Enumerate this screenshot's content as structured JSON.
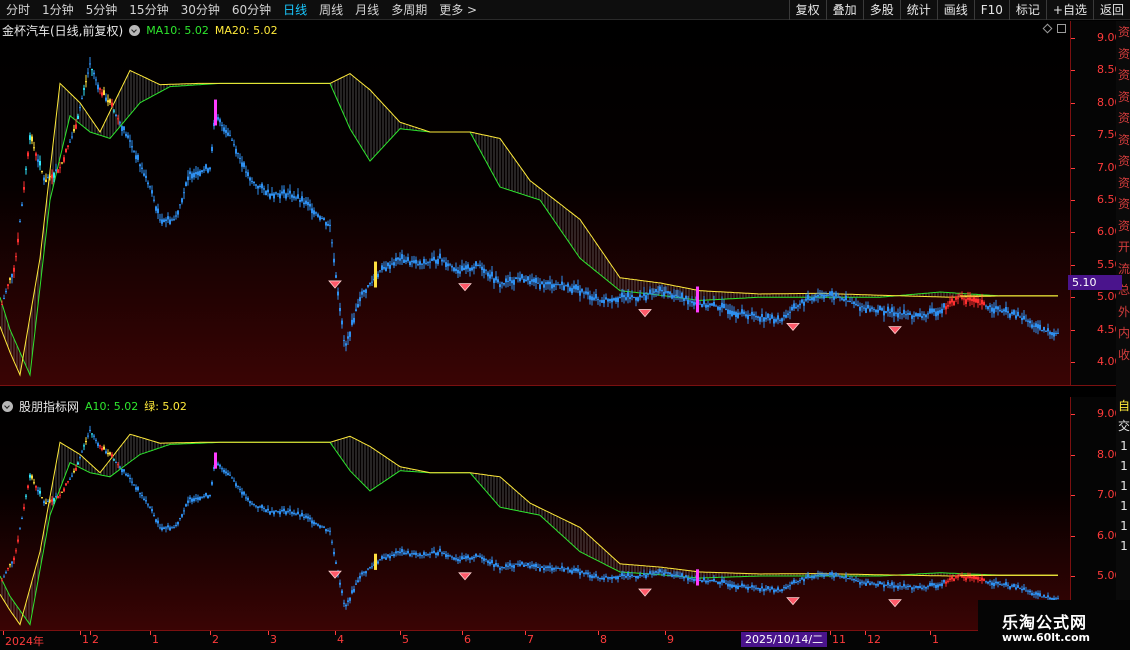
{
  "toolbar": {
    "periods": [
      {
        "label": "分时",
        "active": false
      },
      {
        "label": "1分钟",
        "active": false
      },
      {
        "label": "5分钟",
        "active": false
      },
      {
        "label": "15分钟",
        "active": false
      },
      {
        "label": "30分钟",
        "active": false
      },
      {
        "label": "60分钟",
        "active": false
      },
      {
        "label": "日线",
        "active": true
      },
      {
        "label": "周线",
        "active": false
      },
      {
        "label": "月线",
        "active": false
      },
      {
        "label": "多周期",
        "active": false
      },
      {
        "label": "更多 >",
        "active": false
      }
    ],
    "buttons": [
      "复权",
      "叠加",
      "多股",
      "统计",
      "画线",
      "F10",
      "标记",
      "+自选",
      "返回"
    ]
  },
  "top_pane": {
    "title": "金杯汽车(日线,前复权)",
    "ma10": "MA10: 5.02",
    "ma20": "MA20: 5.02",
    "axis_labels": [
      "9.00",
      "8.50",
      "8.00",
      "7.50",
      "7.00",
      "6.50",
      "6.00",
      "5.50",
      "5.00",
      "4.50",
      "4.00"
    ],
    "axis_values": [
      9.0,
      8.5,
      8.0,
      7.5,
      7.0,
      6.5,
      6.0,
      5.5,
      5.0,
      4.5,
      4.0
    ],
    "current_price": "5.10"
  },
  "bottom_pane": {
    "title": "股朋指标网",
    "a10": "A10: 5.02",
    "green": "绿: 5.02",
    "axis_labels": [
      "9.00",
      "8.00",
      "7.00",
      "6.00",
      "5.00"
    ],
    "axis_values": [
      9.0,
      8.0,
      7.0,
      6.0,
      5.0
    ]
  },
  "side_strip": {
    "top_chars": [
      "资",
      "资",
      "资",
      "资",
      "资",
      "资",
      "资",
      "资",
      "资",
      "资",
      "开",
      "流",
      "总",
      "外",
      "内",
      "收"
    ],
    "bottom_chars": [
      "自",
      "交",
      "1",
      "1",
      "1",
      "1",
      "1",
      "1"
    ]
  },
  "date_axis": {
    "labels": [
      "2024年",
      "1",
      "2",
      "1",
      "2",
      "3",
      "4",
      "5",
      "6",
      "7",
      "8",
      "9",
      "11",
      "12",
      "1"
    ],
    "cursor": "2025/10/14/二"
  },
  "watermark": {
    "title": "乐淘公式网",
    "url": "www.60lt.com"
  },
  "colors": {
    "accent_active": "#19c8ff",
    "axis": "#ff3b3b",
    "ma10": "#2ee62e",
    "ma20": "#ffea3a",
    "price_line": "#2e8fef",
    "band_fill": "#a0a0a0",
    "highlight": "#4a148c"
  },
  "chart_data": [
    {
      "type": "line",
      "title": "金杯汽车(日线,前复权)",
      "ylim": [
        3.75,
        9.2
      ],
      "x_index_range": [
        0,
        520
      ],
      "series": [
        {
          "name": "MA10",
          "points": [
            [
              0,
              4.55
            ],
            [
              10,
              4.15
            ],
            [
              20,
              3.8
            ],
            [
              40,
              5.6
            ],
            [
              60,
              8.3
            ],
            [
              80,
              8.0
            ],
            [
              100,
              7.55
            ],
            [
              130,
              8.5
            ],
            [
              160,
              8.28
            ],
            [
              200,
              8.3
            ],
            [
              260,
              8.3
            ],
            [
              300,
              8.3
            ],
            [
              330,
              8.3
            ],
            [
              350,
              8.45
            ],
            [
              370,
              8.2
            ],
            [
              400,
              7.7
            ],
            [
              430,
              7.55
            ],
            [
              470,
              7.55
            ],
            [
              500,
              7.45
            ],
            [
              530,
              6.8
            ],
            [
              580,
              6.2
            ],
            [
              620,
              5.3
            ],
            [
              660,
              5.22
            ],
            [
              700,
              5.1
            ],
            [
              760,
              5.05
            ],
            [
              820,
              5.06
            ],
            [
              880,
              5.03
            ],
            [
              950,
              5.0
            ],
            [
              1000,
              5.02
            ],
            [
              1060,
              5.02
            ]
          ]
        },
        {
          "name": "MA20",
          "points": [
            [
              0,
              5.0
            ],
            [
              10,
              4.5
            ],
            [
              30,
              3.8
            ],
            [
              50,
              6.5
            ],
            [
              70,
              7.8
            ],
            [
              90,
              7.55
            ],
            [
              110,
              7.45
            ],
            [
              140,
              8.0
            ],
            [
              170,
              8.25
            ],
            [
              220,
              8.3
            ],
            [
              280,
              8.3
            ],
            [
              330,
              8.3
            ],
            [
              350,
              7.6
            ],
            [
              370,
              7.1
            ],
            [
              400,
              7.6
            ],
            [
              430,
              7.55
            ],
            [
              470,
              7.55
            ],
            [
              500,
              6.7
            ],
            [
              540,
              6.5
            ],
            [
              580,
              5.6
            ],
            [
              620,
              5.1
            ],
            [
              650,
              5.05
            ],
            [
              700,
              4.95
            ],
            [
              760,
              5.0
            ],
            [
              820,
              5.0
            ],
            [
              880,
              5.0
            ],
            [
              940,
              5.08
            ],
            [
              1000,
              5.02
            ],
            [
              1060,
              5.02
            ]
          ]
        },
        {
          "name": "close",
          "points": [
            [
              0,
              4.8
            ],
            [
              15,
              5.5
            ],
            [
              30,
              7.5
            ],
            [
              45,
              6.8
            ],
            [
              60,
              7.0
            ],
            [
              75,
              7.6
            ],
            [
              90,
              8.6
            ],
            [
              100,
              8.2
            ],
            [
              110,
              8.0
            ],
            [
              130,
              7.4
            ],
            [
              150,
              6.7
            ],
            [
              160,
              6.2
            ],
            [
              175,
              6.2
            ],
            [
              190,
              6.9
            ],
            [
              210,
              7.0
            ],
            [
              215,
              7.8
            ],
            [
              230,
              7.5
            ],
            [
              250,
              6.8
            ],
            [
              270,
              6.6
            ],
            [
              290,
              6.6
            ],
            [
              310,
              6.4
            ],
            [
              330,
              6.1
            ],
            [
              345,
              4.2
            ],
            [
              360,
              5.0
            ],
            [
              380,
              5.4
            ],
            [
              400,
              5.6
            ],
            [
              420,
              5.5
            ],
            [
              440,
              5.6
            ],
            [
              460,
              5.4
            ],
            [
              480,
              5.5
            ],
            [
              500,
              5.2
            ],
            [
              520,
              5.3
            ],
            [
              540,
              5.2
            ],
            [
              560,
              5.2
            ],
            [
              580,
              5.1
            ],
            [
              600,
              4.95
            ],
            [
              620,
              5.0
            ],
            [
              640,
              5.0
            ],
            [
              660,
              5.1
            ],
            [
              680,
              5.0
            ],
            [
              700,
              4.9
            ],
            [
              720,
              4.85
            ],
            [
              740,
              4.75
            ],
            [
              760,
              4.7
            ],
            [
              780,
              4.65
            ],
            [
              800,
              4.9
            ],
            [
              820,
              5.05
            ],
            [
              840,
              5.0
            ],
            [
              860,
              4.85
            ],
            [
              880,
              4.8
            ],
            [
              900,
              4.75
            ],
            [
              920,
              4.7
            ],
            [
              940,
              4.8
            ],
            [
              960,
              5.0
            ],
            [
              980,
              4.9
            ],
            [
              1000,
              4.8
            ],
            [
              1020,
              4.7
            ],
            [
              1040,
              4.5
            ],
            [
              1055,
              4.45
            ]
          ]
        }
      ]
    }
  ]
}
